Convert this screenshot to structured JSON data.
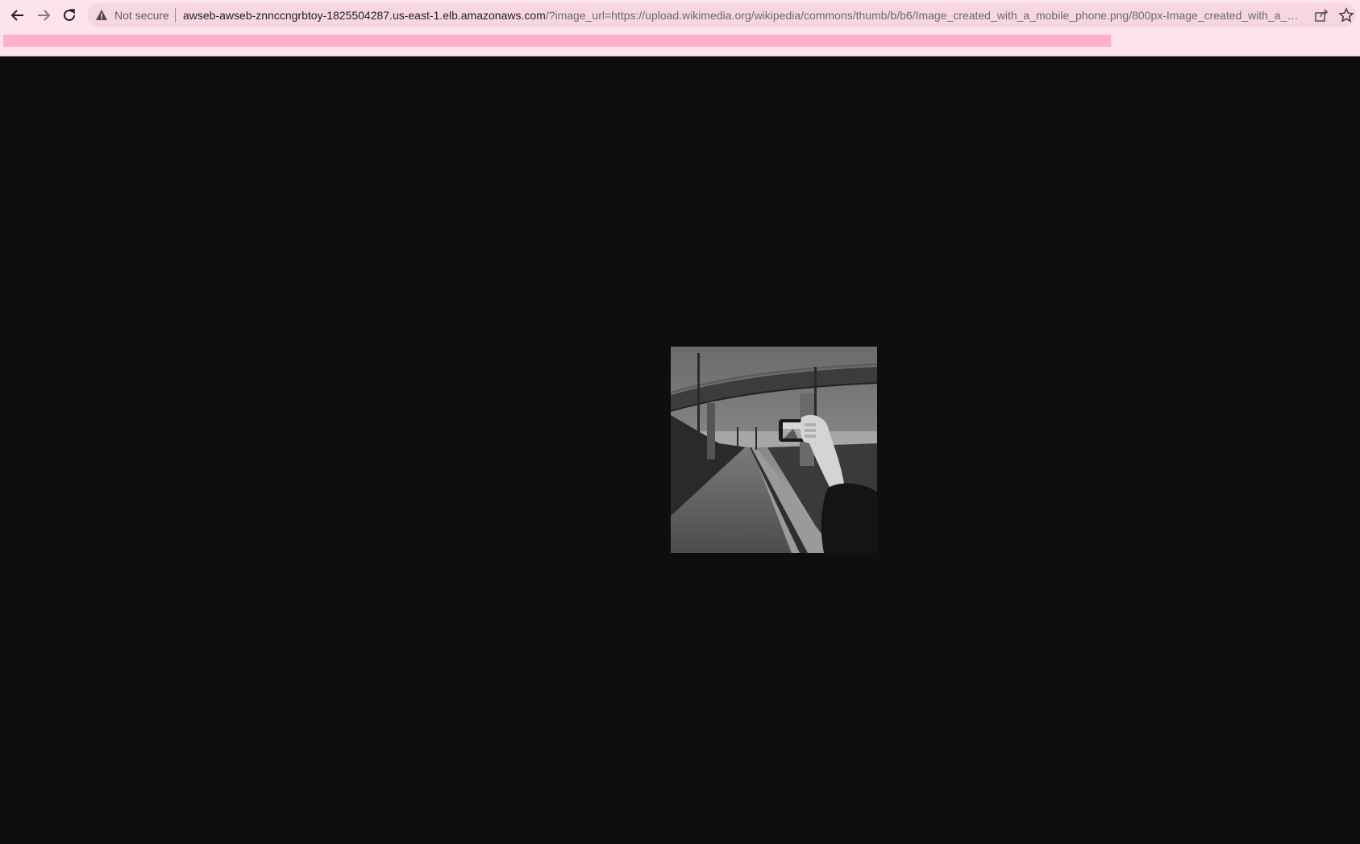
{
  "browser": {
    "security_label": "Not secure",
    "url_host": "awseb-awseb-znnccngrbtoy-1825504287.us-east-1.elb.amazonaws.com",
    "url_rest": "/?image_url=https://upload.wikimedia.org/wikipedia/commons/thumb/b/b6/Image_created_with_a_mobile_phone.png/800px-Image_created_with_a_m...",
    "icons": {
      "back": "back-arrow-icon",
      "forward": "forward-arrow-icon",
      "reload": "reload-icon",
      "warning": "warning-triangle-icon",
      "share": "share-icon",
      "bookmark": "star-icon"
    },
    "colors": {
      "toolbar": "#fde3ea",
      "omnibox": "#f7d6df",
      "accent_bar": "#ffb1cc"
    }
  },
  "page": {
    "background": "#0e0e0e",
    "image": "grayscale photo of a hand holding a mobile phone photographing a road under an overpass"
  }
}
